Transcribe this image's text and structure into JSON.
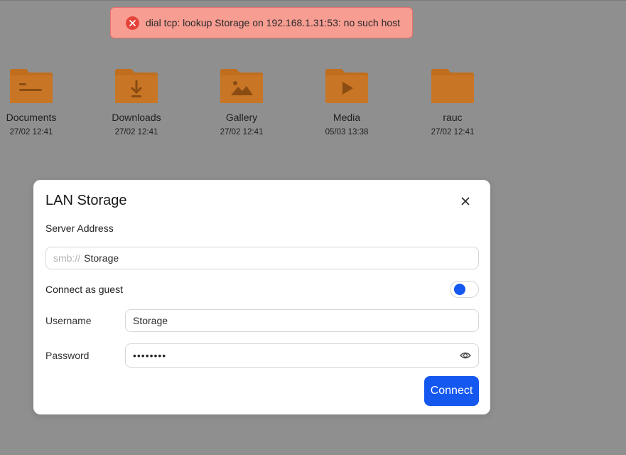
{
  "toast": {
    "message": "dial tcp: lookup Storage on 192.168.1.31:53: no such host",
    "color": "#f79d92"
  },
  "folders": [
    {
      "name": "Documents",
      "date": "27/02 12:41",
      "icon": "document-folder-icon"
    },
    {
      "name": "Downloads",
      "date": "27/02 12:41",
      "icon": "download-folder-icon"
    },
    {
      "name": "Gallery",
      "date": "27/02 12:41",
      "icon": "image-folder-icon"
    },
    {
      "name": "Media",
      "date": "05/03 13:38",
      "icon": "media-folder-icon"
    },
    {
      "name": "rauc",
      "date": "27/02 12:41",
      "icon": "folder-icon"
    }
  ],
  "folder_color": "#c06d1e",
  "dialog": {
    "title": "LAN Storage",
    "server_label": "Server Address",
    "server_prefix": "smb://",
    "server_value": "Storage",
    "guest_label": "Connect as guest",
    "guest_enabled": false,
    "username_label": "Username",
    "username_value": "Storage",
    "password_label": "Password",
    "password_value": "••••••••",
    "connect_label": "Connect",
    "accent": "#1558f0"
  }
}
